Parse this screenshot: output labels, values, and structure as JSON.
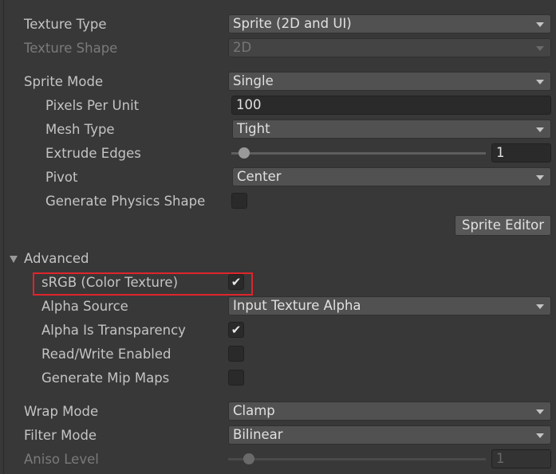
{
  "texture_type": {
    "label": "Texture Type",
    "value": "Sprite (2D and UI)"
  },
  "texture_shape": {
    "label": "Texture Shape",
    "value": "2D"
  },
  "sprite_mode": {
    "label": "Sprite Mode",
    "value": "Single"
  },
  "pixels_per_unit": {
    "label": "Pixels Per Unit",
    "value": "100"
  },
  "mesh_type": {
    "label": "Mesh Type",
    "value": "Tight"
  },
  "extrude_edges": {
    "label": "Extrude Edges",
    "value": "1",
    "slider_fraction": 0.03
  },
  "pivot": {
    "label": "Pivot",
    "value": "Center"
  },
  "physics_shape": {
    "label": "Generate Physics Shape",
    "checked": false
  },
  "sprite_editor": {
    "label": "Sprite Editor"
  },
  "advanced": {
    "label": "Advanced",
    "expanded": true
  },
  "srgb": {
    "label": "sRGB (Color Texture)",
    "checked": true,
    "highlight_color": "#e0242c"
  },
  "alpha_source": {
    "label": "Alpha Source",
    "value": "Input Texture Alpha"
  },
  "alpha_transparency": {
    "label": "Alpha Is Transparency",
    "checked": true
  },
  "read_write": {
    "label": "Read/Write Enabled",
    "checked": false
  },
  "mip_maps": {
    "label": "Generate Mip Maps",
    "checked": false
  },
  "wrap_mode": {
    "label": "Wrap Mode",
    "value": "Clamp"
  },
  "filter_mode": {
    "label": "Filter Mode",
    "value": "Bilinear"
  },
  "aniso_level": {
    "label": "Aniso Level",
    "value": "1",
    "slider_fraction": 0.06
  },
  "check_glyph": "✔"
}
